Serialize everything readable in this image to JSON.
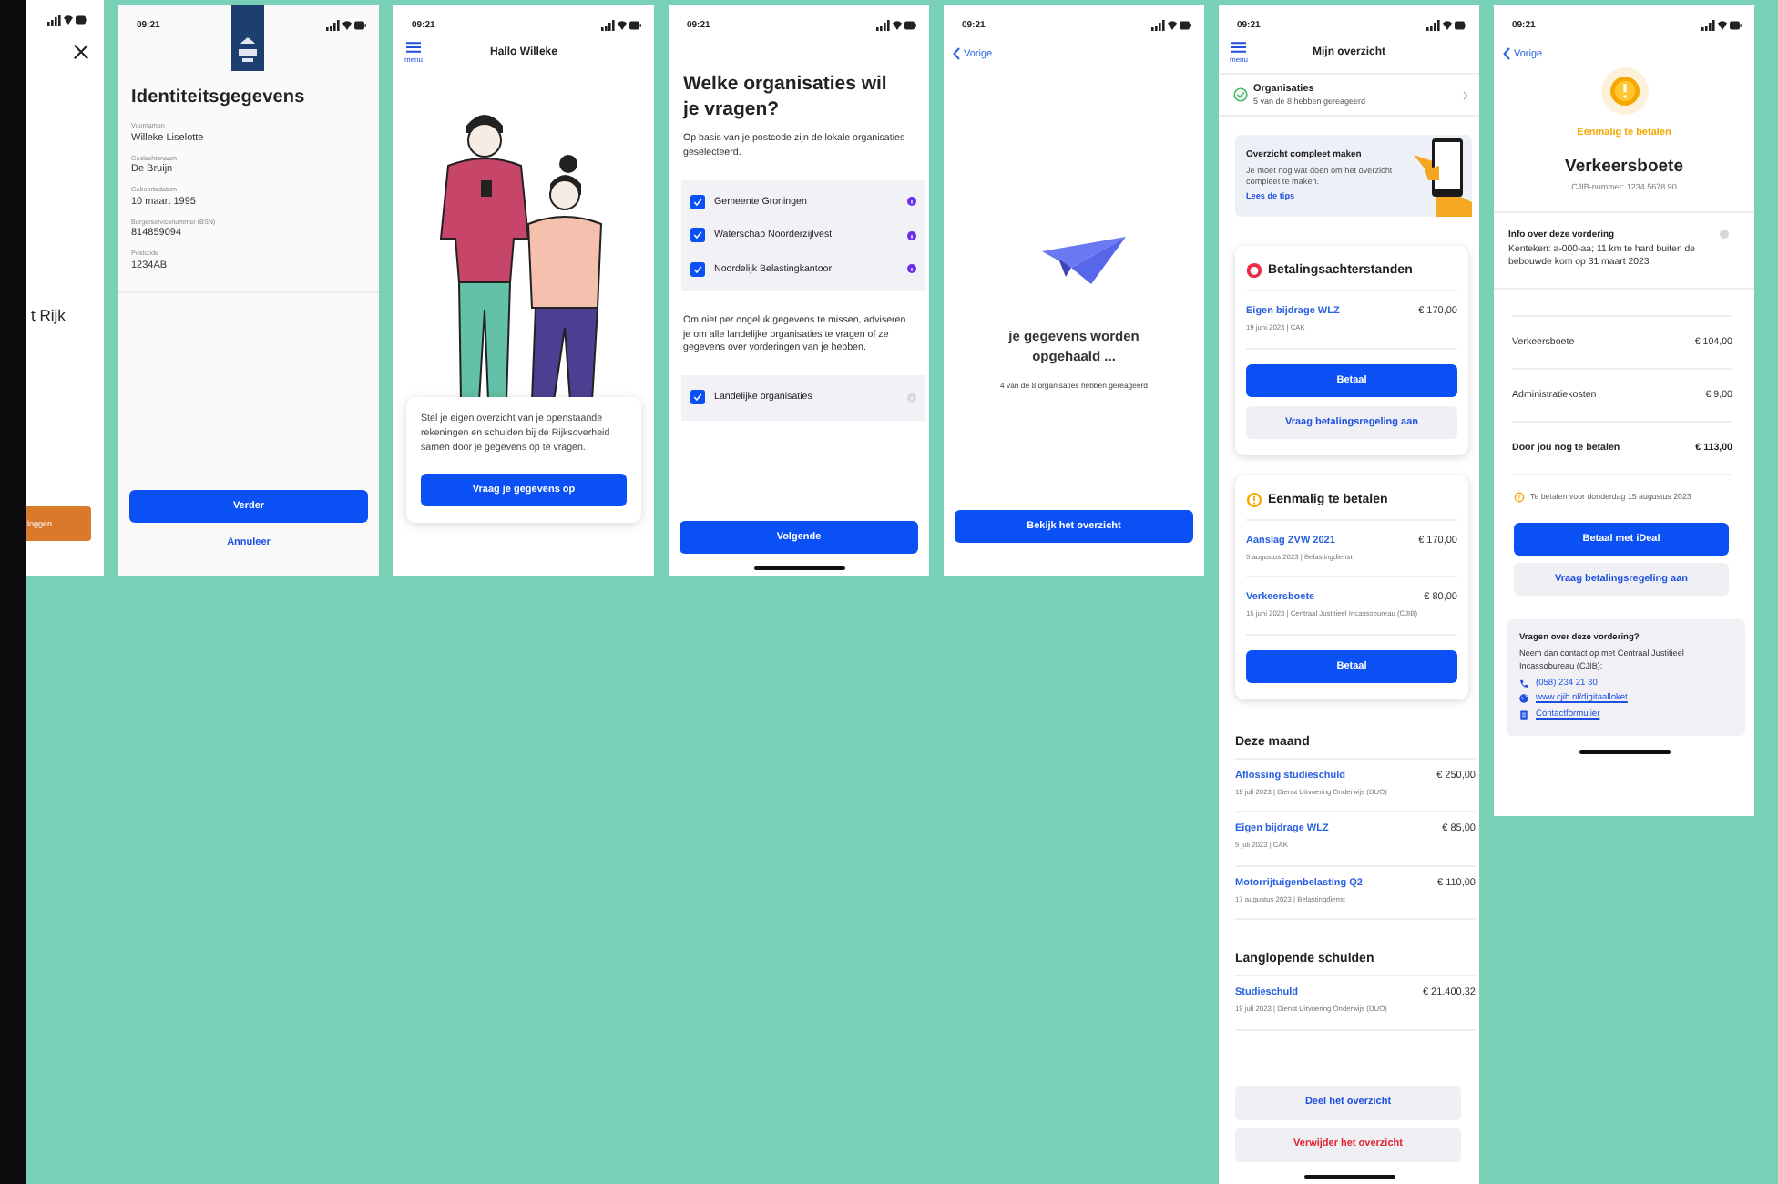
{
  "screens": [
    {
      "kind": "partial",
      "text": "t Rijk",
      "button": "loggen"
    },
    {
      "kind": "identity",
      "time": "09:21",
      "title": "Identiteitsgegevens",
      "fields": [
        {
          "label": "Voornamen",
          "value": "Willeke Liselotte"
        },
        {
          "label": "Geslachtsnaam",
          "value": "De Bruijn"
        },
        {
          "label": "Geboortedatum",
          "value": "10 maart 1995"
        },
        {
          "label": "Burgerservicenummer (BSN)",
          "value": "814859094"
        },
        {
          "label": "Postcode",
          "value": "1234AB"
        }
      ],
      "primary": "Verder",
      "secondary": "Annuleer"
    },
    {
      "kind": "welcome",
      "time": "09:21",
      "menu": "menu",
      "title": "Hallo Willeke",
      "card_text": "Stel je eigen overzicht van je openstaande rekeningen en schulden bij de Rijksoverheid samen door je gegevens op te vragen.",
      "button": "Vraag je gegevens op"
    },
    {
      "kind": "organisations",
      "time": "09:21",
      "title": "Welke organisaties wil je vragen?",
      "intro": "Op basis van je postcode zijn de lokale organisaties geselecteerd.",
      "local": [
        {
          "name": "Gemeente Groningen",
          "checked": true
        },
        {
          "name": "Waterschap Noorderzijlvest",
          "checked": true
        },
        {
          "name": "Noordelijk Belastingkantoor",
          "checked": true
        }
      ],
      "advice": "Om niet per ongeluk gegevens te missen, adviseren je om alle landelijke organisaties te vragen of ze gegevens over vorderingen van je hebben.",
      "national": [
        {
          "name": "Landelijke organisaties",
          "checked": true
        }
      ],
      "button": "Volgende"
    },
    {
      "kind": "loading",
      "time": "09:21",
      "back": "Vorige",
      "title": "je gegevens worden opgehaald ...",
      "status": "4 van de 8 organisaties hebben gereageerd",
      "button": "Bekijk het overzicht"
    },
    {
      "kind": "overview",
      "time": "09:21",
      "menu": "menu",
      "title": "Mijn overzicht",
      "organisations": {
        "title": "Organisaties",
        "subtitle": "5 van de 8 hebben gereageerd"
      },
      "tips": {
        "title": "Overzicht compleet maken",
        "text": "Je moet nog wat doen om het overzicht compleet te maken.",
        "link": "Lees de tips"
      },
      "cards": [
        {
          "kind": "arrears",
          "title": "Betalingsachterstanden",
          "items": [
            {
              "name": "Eigen bijdrage WLZ",
              "amount": "€ 170,00",
              "meta": "19 juni 2023 | CAK"
            }
          ],
          "buttons": [
            {
              "kind": "primary",
              "label": "Betaal"
            },
            {
              "kind": "secondary",
              "label": "Vraag betalingsregeling aan"
            }
          ]
        },
        {
          "kind": "once",
          "title": "Eenmalig te betalen",
          "items": [
            {
              "name": "Aanslag ZVW 2021",
              "amount": "€ 170,00",
              "meta": "5 augustus 2023 | Belastingdienst"
            },
            {
              "name": "Verkeersboete",
              "amount": "€ 80,00",
              "meta": "15 juni 2023 | Centraal Justitieel Incassobureau (CJIB)"
            }
          ],
          "buttons": [
            {
              "kind": "primary",
              "label": "Betaal"
            }
          ]
        }
      ],
      "sections": [
        {
          "title": "Deze maand",
          "items": [
            {
              "name": "Aflossing studieschuld",
              "amount": "€ 250,00",
              "meta": "19 juli 2023 | Dienst Uitvoering Onderwijs (DUO)"
            },
            {
              "name": "Eigen bijdrage WLZ",
              "amount": "€ 85,00",
              "meta": "5 juli 2023 | CAK"
            },
            {
              "name": "Motorrijtuigenbelasting Q2",
              "amount": "€ 110,00",
              "meta": "17 augustus 2023 | Belastingdienst"
            }
          ]
        },
        {
          "title": "Langlopende schulden",
          "items": [
            {
              "name": "Studieschuld",
              "amount": "€ 21.400,32",
              "meta": "19 juli 2023 | Dienst Uitvoering Onderwijs (DUO)"
            }
          ]
        }
      ],
      "actions": [
        {
          "kind": "share",
          "label": "Deel het overzicht"
        },
        {
          "kind": "delete",
          "label": "Verwijder het overzicht"
        }
      ]
    },
    {
      "kind": "detail",
      "time": "09:21",
      "back": "Vorige",
      "category": "Eenmalig te betalen",
      "title": "Verkeersboete",
      "reference": "CJIB-nummer: 1234 5678 90",
      "info": {
        "title": "Info over deze vordering",
        "text": "Kenteken: a-000-aa; 11 km te hard buiten de bebouwde kom op 31 maart 2023"
      },
      "lines": [
        {
          "label": "Verkeersboete",
          "amount": "€ 104,00",
          "total": false
        },
        {
          "label": "Administratiekosten",
          "amount": "€ 9,00",
          "total": false
        },
        {
          "label": "Door jou nog te betalen",
          "amount": "€ 113,00",
          "total": true
        }
      ],
      "deadline": "Te betalen voor donderdag 15 augustus 2023",
      "buttons": [
        {
          "kind": "primary",
          "label": "Betaal met iDeal"
        },
        {
          "kind": "secondary",
          "label": "Vraag betalingsregeling aan"
        }
      ],
      "contact": {
        "title": "Vragen over deze vordering?",
        "text": "Neem dan contact op met Centraal Justitieel Incassobureau (CJIB):",
        "links": [
          {
            "kind": "phone",
            "label": "(058) 234 21 30"
          },
          {
            "kind": "web",
            "label": "www.cjib.nl/digitaalloket"
          },
          {
            "kind": "form",
            "label": "Contactformulier"
          }
        ]
      }
    }
  ]
}
